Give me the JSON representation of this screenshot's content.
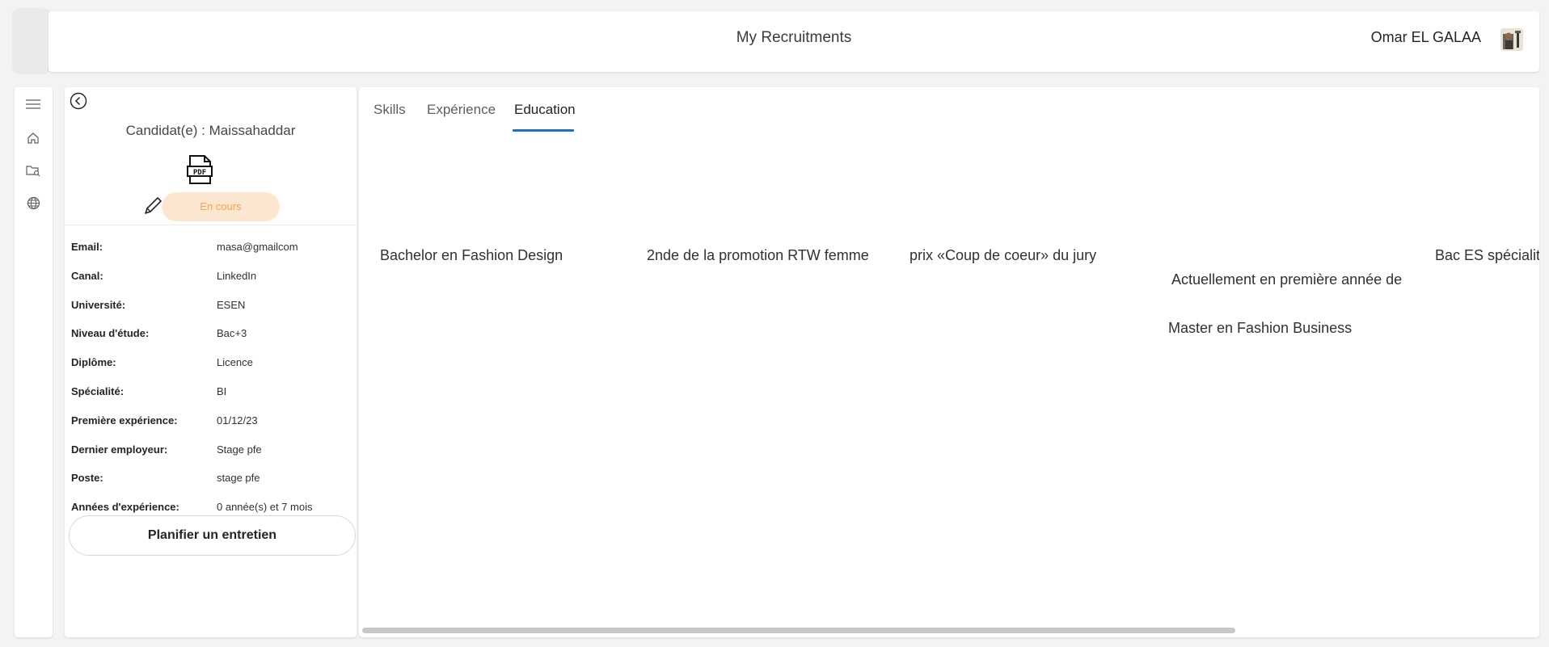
{
  "header": {
    "title": "My Recruitments",
    "user_name": "Omar EL GALAA"
  },
  "nav": {
    "items": [
      "menu-icon",
      "home-icon",
      "folder-search-icon",
      "globe-icon"
    ]
  },
  "candidate": {
    "title": "Candidat(e) : Maissahaddar",
    "status": "En cours",
    "fields": [
      {
        "label": "Email:",
        "value": "masa@gmailcom"
      },
      {
        "label": "Canal:",
        "value": "LinkedIn"
      },
      {
        "label": "Université:",
        "value": "ESEN"
      },
      {
        "label": "Niveau d'étude:",
        "value": "Bac+3"
      },
      {
        "label": "Diplôme:",
        "value": "Licence"
      },
      {
        "label": "Spécialité:",
        "value": "BI"
      },
      {
        "label": "Première expérience:",
        "value": "01/12/23"
      },
      {
        "label": "Dernier employeur:",
        "value": "Stage pfe"
      },
      {
        "label": "Poste:",
        "value": "stage pfe"
      },
      {
        "label": "Années d'expérience:",
        "value": "0 année(s) et 7 mois"
      }
    ],
    "plan_button": "Planifier un entretien"
  },
  "tabs": [
    {
      "label": "Skills",
      "active": false
    },
    {
      "label": "Expérience",
      "active": false
    },
    {
      "label": "Education",
      "active": true
    }
  ],
  "education": [
    {
      "line1": "Bachelor en Fashion Design",
      "line2": ""
    },
    {
      "line1": "2nde de la promotion RTW femme",
      "line2": ""
    },
    {
      "line1": "prix «Coup de coeur» du jury",
      "line2": ""
    },
    {
      "line1": " Actuellement en première année de",
      "line2": "Master en Fashion Business"
    },
    {
      "line1": "Bac ES spécialité",
      "line2": ""
    }
  ],
  "colors": {
    "accent": "#1f6fc5",
    "status_bg": "#fbe7cf",
    "status_text": "#f5a548"
  }
}
